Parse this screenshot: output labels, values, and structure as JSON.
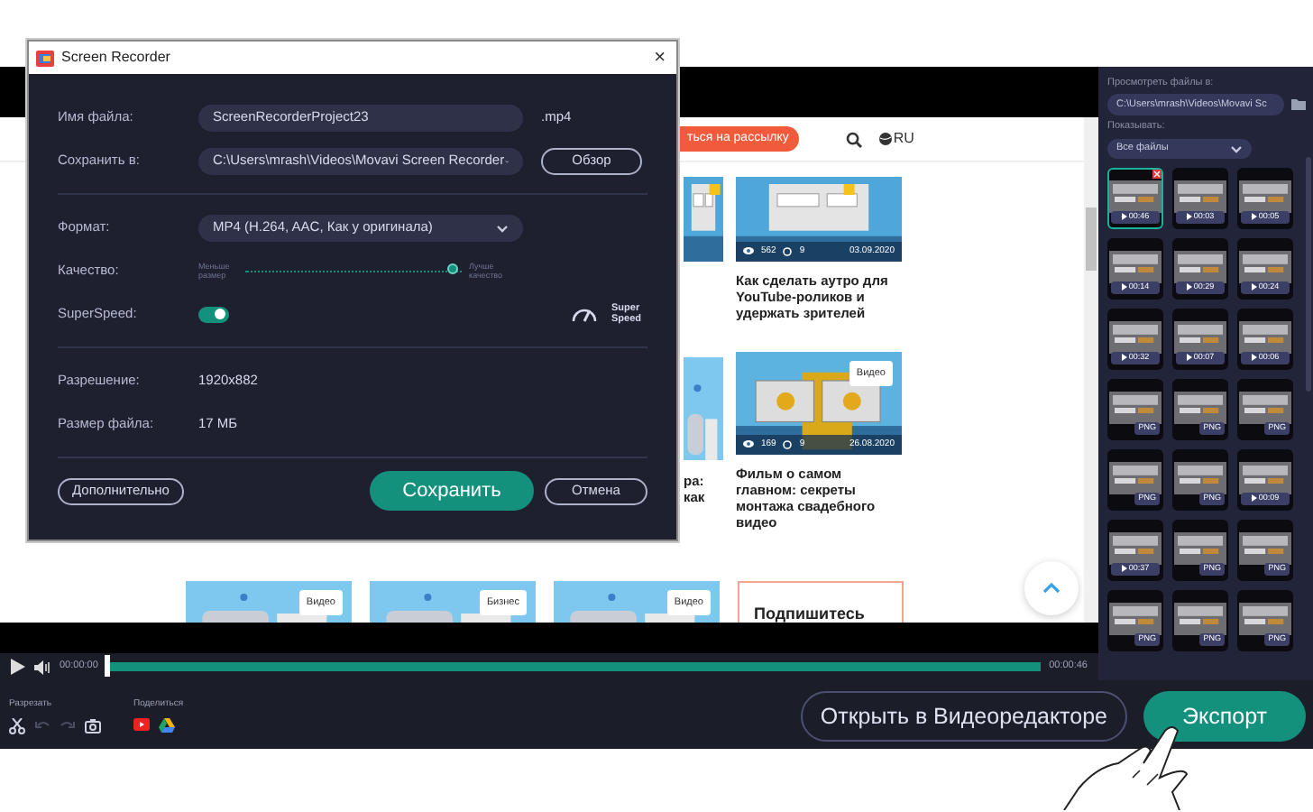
{
  "dialog": {
    "title": "Screen Recorder",
    "close": "×",
    "sections": [
      [
        {
          "kind": "text",
          "label": "Имя файла:",
          "value": "ScreenRecorderProject23",
          "suffix": ".mp4"
        },
        {
          "kind": "select",
          "label": "Сохранить в:",
          "value": "C:\\Users\\mrash\\Videos\\Movavi Screen Recorder",
          "button": "Обзор"
        }
      ],
      [
        {
          "kind": "select",
          "label": "Формат:",
          "value": "MP4 (H.264, AAC, Как у оригинала)"
        },
        {
          "kind": "slider",
          "label": "Качество:",
          "min_label": "Меньше размер",
          "max_label": "Лучше качество",
          "level": 0.96
        },
        {
          "kind": "toggle",
          "label": "SuperSpeed:",
          "on": true,
          "badge": "Super Speed"
        }
      ],
      [
        {
          "kind": "info",
          "label": "Разрешение:",
          "value": "1920x882"
        },
        {
          "kind": "info",
          "label": "Размер файла:",
          "value": "17 МБ"
        }
      ]
    ],
    "buttons": [
      {
        "label": "Дополнительно",
        "kind": "outline"
      },
      {
        "label": "Сохранить",
        "kind": "primary"
      },
      {
        "label": "Отмена",
        "kind": "outline"
      }
    ]
  },
  "webpage": {
    "subscribe": "ться на рассылку",
    "language": "RU",
    "fragments": [
      "ра:",
      "как"
    ],
    "articles": [
      {
        "stats": [
          "562",
          "9"
        ],
        "date": "03.09.2020",
        "title": "Как сделать аутро для YouTube-роликов и удержать зрителей"
      },
      {
        "badge": "Видео",
        "stats": [
          "169",
          "9"
        ],
        "date": "26.08.2020",
        "title": "Фильм о самом главном: секреты монтажа свадебного видео"
      }
    ],
    "bottom_cards": [
      {
        "badge": "Видео"
      },
      {
        "badge": "Бизнес"
      },
      {
        "badge": "Видео"
      }
    ],
    "subscribe_box": "Подпишитесь"
  },
  "sidebar": {
    "browse_label": "Просмотреть файлы в:",
    "path": "C:\\Users\\mrash\\Videos\\Movavi Sc",
    "show_label": "Показывать:",
    "filter": "Все файлы",
    "files": [
      {
        "kind": "video",
        "label": "00:46",
        "selected": true
      },
      {
        "kind": "video",
        "label": "00:03",
        "selected": false
      },
      {
        "kind": "video",
        "label": "00:05",
        "selected": false
      },
      {
        "kind": "video",
        "label": "00:14",
        "selected": false
      },
      {
        "kind": "video",
        "label": "00:29",
        "selected": false
      },
      {
        "kind": "video",
        "label": "00:24",
        "selected": false
      },
      {
        "kind": "video",
        "label": "00:32",
        "selected": false
      },
      {
        "kind": "video",
        "label": "00:07",
        "selected": false
      },
      {
        "kind": "video",
        "label": "00:06",
        "selected": false
      },
      {
        "label": "PNG",
        "selected": false
      },
      {
        "label": "PNG",
        "selected": false
      },
      {
        "label": "PNG",
        "selected": false
      },
      {
        "label": "PNG",
        "selected": false
      },
      {
        "label": "PNG",
        "selected": false
      },
      {
        "kind": "video",
        "label": "00:09",
        "selected": false
      },
      {
        "kind": "video",
        "label": "00:37",
        "selected": false
      },
      {
        "label": "PNG",
        "selected": false
      },
      {
        "label": "PNG",
        "selected": false
      },
      {
        "label": "PNG",
        "selected": false
      },
      {
        "label": "PNG",
        "selected": false
      },
      {
        "label": "PNG",
        "selected": false
      }
    ]
  },
  "timeline": {
    "start": "00:00:00",
    "end": "00:00:46",
    "level": 0
  },
  "toolbar": {
    "cut_label": "Разрезать",
    "share_label": "Поделиться",
    "tools": [
      {
        "kind": "scissors",
        "disabled": false
      },
      {
        "kind": "undo",
        "disabled": true
      },
      {
        "kind": "redo",
        "disabled": true
      },
      {
        "kind": "snapshot",
        "disabled": false
      }
    ],
    "share": [
      {
        "kind": "youtube"
      },
      {
        "kind": "drive"
      }
    ]
  },
  "actions": [
    {
      "label": "Открыть в Видеоредакторе",
      "kind": "outline"
    },
    {
      "label": "Экспорт",
      "kind": "primary"
    }
  ]
}
